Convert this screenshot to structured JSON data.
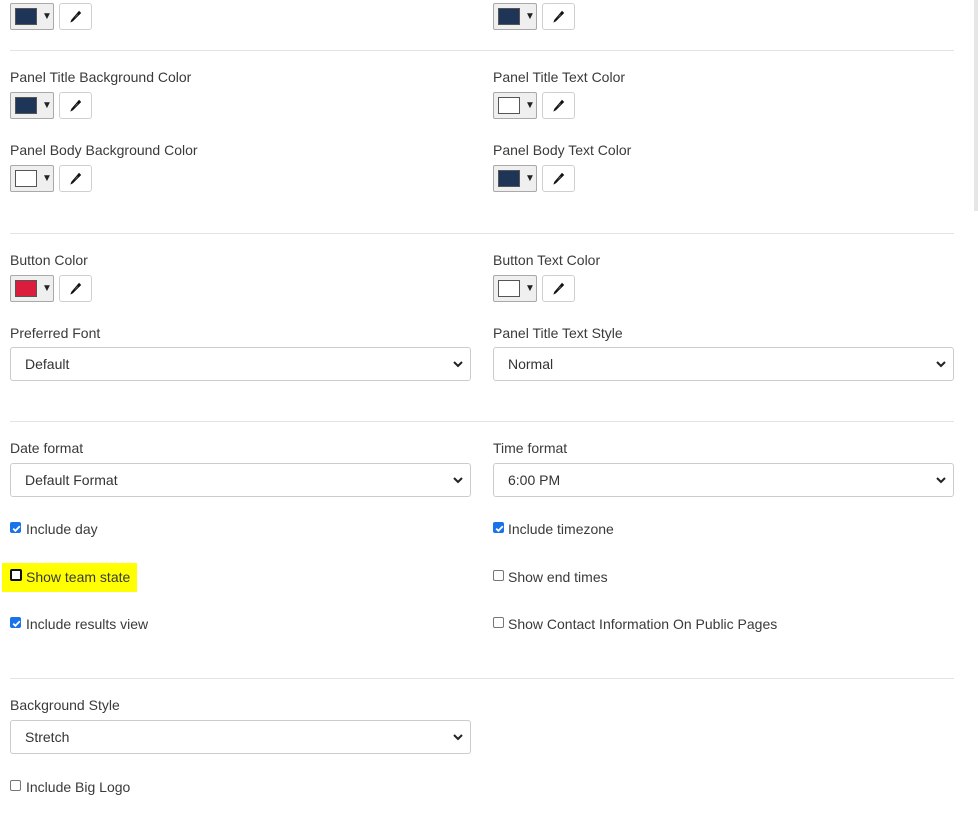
{
  "colors": {
    "navy": "#1f3558",
    "white": "#ffffff",
    "crimson": "#dc1c3c",
    "highlight": "#ffff00",
    "checkbox_blue": "#1a73e8"
  },
  "pickers": {
    "top_left": {
      "color": "#1f3558"
    },
    "top_right": {
      "color": "#1f3558"
    },
    "panel_title_bg": {
      "label": "Panel Title Background Color",
      "color": "#1f3558"
    },
    "panel_title_text": {
      "label": "Panel Title Text Color",
      "color": "#ffffff"
    },
    "panel_body_bg": {
      "label": "Panel Body Background Color",
      "color": "#ffffff"
    },
    "panel_body_text": {
      "label": "Panel Body Text Color",
      "color": "#1f3558"
    },
    "button_color": {
      "label": "Button Color",
      "color": "#dc1c3c"
    },
    "button_text": {
      "label": "Button Text Color",
      "color": "#ffffff"
    }
  },
  "selects": {
    "preferred_font": {
      "label": "Preferred Font",
      "value": "Default"
    },
    "panel_title_style": {
      "label": "Panel Title Text Style",
      "value": "Normal"
    },
    "date_format": {
      "label": "Date format",
      "value": "Default Format"
    },
    "time_format": {
      "label": "Time format",
      "value": "6:00 PM"
    },
    "background_style": {
      "label": "Background Style",
      "value": "Stretch"
    }
  },
  "checkboxes": {
    "include_day": {
      "label": "Include day",
      "checked": true
    },
    "include_timezone": {
      "label": "Include timezone",
      "checked": true
    },
    "show_team_state": {
      "label": "Show team state",
      "checked": false
    },
    "show_end_times": {
      "label": "Show end times",
      "checked": false
    },
    "include_results_view": {
      "label": "Include results view",
      "checked": true
    },
    "show_contact_info": {
      "label": "Show Contact Information On Public Pages",
      "checked": false
    },
    "include_big_logo": {
      "label": "Include Big Logo",
      "checked": false
    }
  },
  "icons": {
    "dropper": "eyedropper-icon",
    "caret": "caret-down-icon",
    "chevron": "chevron-down-icon",
    "check": "checkmark-icon"
  }
}
